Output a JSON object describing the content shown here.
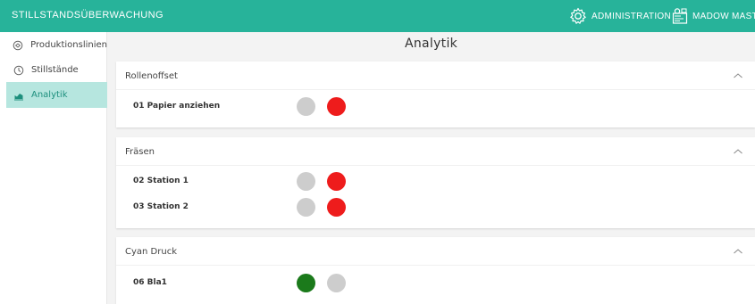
{
  "header": {
    "app_title": "STILLSTANDSÜBERWACHUNG",
    "admin_label": "ADMINISTRATION",
    "user_label": "MADOW MASTE"
  },
  "sidebar": {
    "items": [
      {
        "label": "Produktionslinien",
        "icon": "production-lines-icon",
        "active": false
      },
      {
        "label": "Stillstände",
        "icon": "clock-icon",
        "active": false
      },
      {
        "label": "Analytik",
        "icon": "chart-icon",
        "active": true
      }
    ]
  },
  "main": {
    "title": "Analytik",
    "sections": [
      {
        "title": "Rollenoffset",
        "rows": [
          {
            "label": "01 Papier anziehen",
            "status": [
              "grey",
              "red"
            ]
          }
        ]
      },
      {
        "title": "Fräsen",
        "rows": [
          {
            "label": "02 Station 1",
            "status": [
              "grey",
              "red"
            ]
          },
          {
            "label": "03 Station 2",
            "status": [
              "grey",
              "red"
            ]
          }
        ]
      },
      {
        "title": "Cyan Druck",
        "rows": [
          {
            "label": "06 Bla1",
            "status": [
              "green",
              "grey"
            ]
          }
        ]
      }
    ]
  },
  "colors": {
    "accent": "#27b39a",
    "active_bg": "#b6e6df",
    "red": "#ee1c1c",
    "grey": "#cdcdcd",
    "green": "#1b7a1b"
  }
}
